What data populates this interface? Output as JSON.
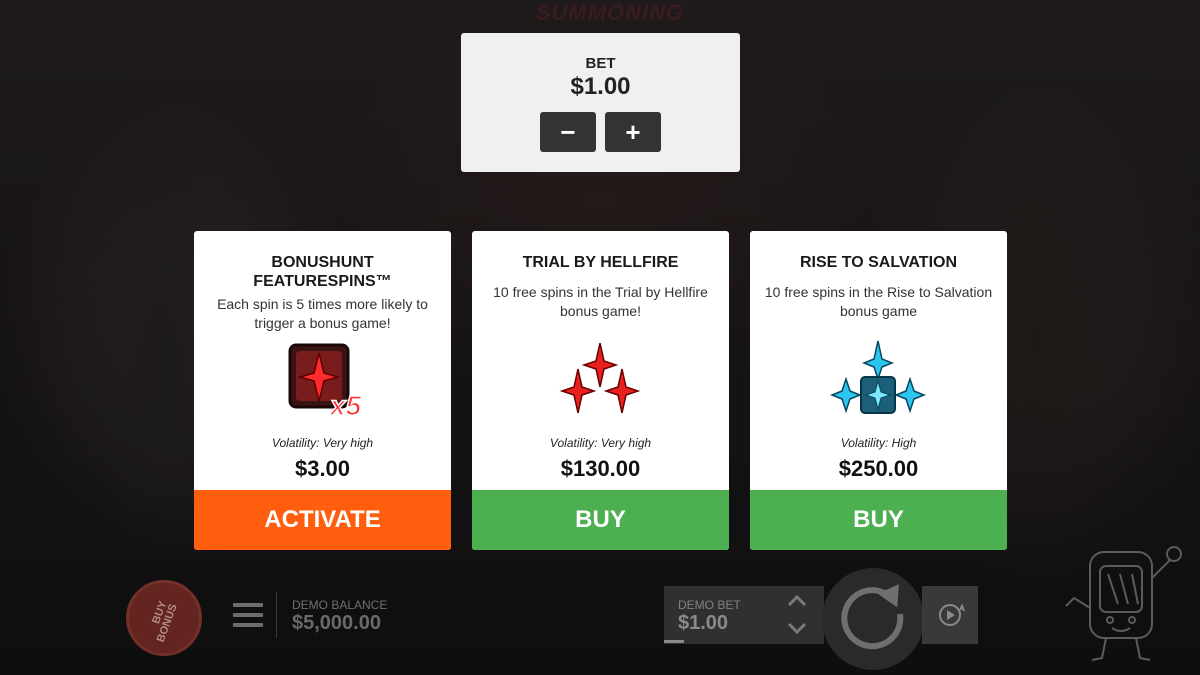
{
  "background": {
    "logo_text": "SUMMONING"
  },
  "bet_panel": {
    "label": "BET",
    "value": "$1.00",
    "decrease_label": "−",
    "increase_label": "+"
  },
  "cards": [
    {
      "title_line1": "BONUSHUNT",
      "title_line2": "FEATURESPINS™",
      "description": "Each spin is 5 times more likely to trigger a bonus game!",
      "icon": "red-block-x5-icon",
      "volatility": "Volatility: Very high",
      "price": "$3.00",
      "action_label": "ACTIVATE",
      "action_color": "#ff5e0e"
    },
    {
      "title": "TRIAL BY HELLFIRE",
      "description": "10 free spins in the Trial by Hellfire bonus game!",
      "icon": "red-crosses-icon",
      "volatility": "Volatility: Very high",
      "price": "$130.00",
      "action_label": "BUY",
      "action_color": "#4caf50"
    },
    {
      "title": "RISE TO SALVATION",
      "description": "10 free spins in the Rise to Salvation bonus game",
      "icon": "blue-crosses-icon",
      "volatility": "Volatility: High",
      "price": "$250.00",
      "action_label": "BUY",
      "action_color": "#4caf50"
    }
  ],
  "bottom_bar": {
    "buy_bonus_line1": "BUY",
    "buy_bonus_line2": "BONUS",
    "demo_balance_label": "DEMO BALANCE",
    "demo_balance_value": "$5,000.00",
    "demo_bet_label": "DEMO BET",
    "demo_bet_value": "$1.00"
  }
}
